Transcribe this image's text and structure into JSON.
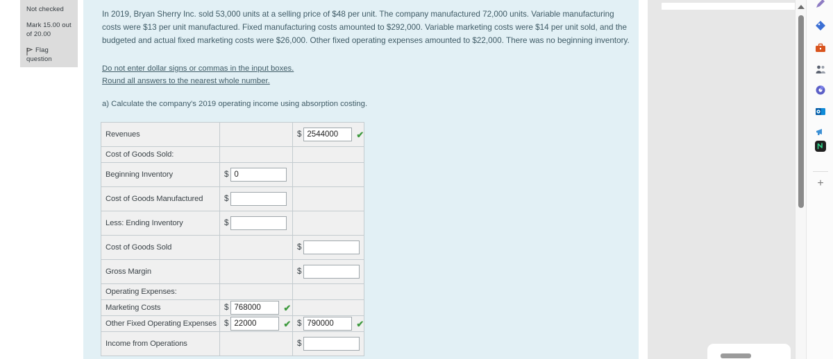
{
  "sidebar": {
    "status": "Not checked",
    "mark_line1": "Mark 15.00 out",
    "mark_line2": "of 20.00",
    "flag_label": "Flag",
    "flag_label2": "question",
    "flag_icon": "flag-icon"
  },
  "question": {
    "body": "In 2019, Bryan Sherry Inc. sold 53,000 units at a selling price of $48 per unit. The company manufactured 72,000 units. Variable manufacturing costs were $13 per unit manufactured. Fixed manufacturing costs amounted to $292,000. Variable marketing costs were $14 per unit sold, and the budgeted and actual fixed marketing costs were $26,000. Other fixed operating expenses amounted to $22,000. There was no beginning inventory.",
    "instruction1": "Do not enter dollar signs or commas in the input boxes.",
    "instruction2": "Round all answers to the nearest whole number.",
    "part_a": "a) Calculate the company's 2019 operating income using absorption costing."
  },
  "table": {
    "dollar_sign": "$",
    "check_glyph": "✔",
    "rows": [
      {
        "label": "Revenues",
        "mid_value": null,
        "mid_input": false,
        "mid_check": false,
        "right_value": "2544000",
        "right_input": true,
        "right_check": true
      },
      {
        "label": "Cost of Goods Sold:",
        "mid_value": null,
        "mid_input": false,
        "mid_check": false,
        "right_value": null,
        "right_input": false,
        "right_check": false
      },
      {
        "label": "Beginning Inventory",
        "mid_value": "0",
        "mid_input": true,
        "mid_check": false,
        "right_value": null,
        "right_input": false,
        "right_check": false
      },
      {
        "label": "Cost of Goods Manufactured",
        "mid_value": "",
        "mid_input": true,
        "mid_check": false,
        "right_value": null,
        "right_input": false,
        "right_check": false
      },
      {
        "label": "Less: Ending Inventory",
        "mid_value": "",
        "mid_input": true,
        "mid_check": false,
        "right_value": null,
        "right_input": false,
        "right_check": false
      },
      {
        "label": "Cost of Goods Sold",
        "mid_value": null,
        "mid_input": false,
        "mid_check": false,
        "right_value": "",
        "right_input": true,
        "right_check": false
      },
      {
        "label": "Gross Margin",
        "mid_value": null,
        "mid_input": false,
        "mid_check": false,
        "right_value": "",
        "right_input": true,
        "right_check": false
      },
      {
        "label": "Operating Expenses:",
        "mid_value": null,
        "mid_input": false,
        "mid_check": false,
        "right_value": null,
        "right_input": false,
        "right_check": false
      },
      {
        "label": "Marketing Costs",
        "mid_value": "768000",
        "mid_input": true,
        "mid_check": true,
        "right_value": null,
        "right_input": false,
        "right_check": false
      },
      {
        "label": "Other Fixed Operating Expenses",
        "mid_value": "22000",
        "mid_input": true,
        "mid_check": true,
        "right_value": "790000",
        "right_input": true,
        "right_check": true
      },
      {
        "label": "Income from Operations",
        "mid_value": null,
        "mid_input": false,
        "mid_check": false,
        "right_value": "",
        "right_input": true,
        "right_check": false
      }
    ]
  },
  "rail": {
    "items": [
      {
        "name": "pen-icon",
        "color": "#8e7cc3"
      },
      {
        "name": "tag-icon",
        "color": "#3b6fd4"
      },
      {
        "name": "briefcase-icon",
        "color": "#d9541e"
      },
      {
        "name": "people-icon",
        "color": "#5b6270"
      },
      {
        "name": "teams-icon",
        "color": "#5b5fc7"
      },
      {
        "name": "outlook-icon",
        "color": "#0f8bd8"
      },
      {
        "name": "megaphone-icon",
        "color": "#3b8fd4"
      },
      {
        "name": "notes-app-icon",
        "color": "#1f1f1f"
      }
    ],
    "add_label": "+"
  },
  "scrollbar": {
    "name": "vertical-scrollbar"
  },
  "colors": {
    "question_bg": "#e2f0f5",
    "question_text": "#3f5b66",
    "table_cell_bg": "#f0f0f0",
    "check_green": "#3f9a3f",
    "panel_gray": "#e7e7e7"
  }
}
